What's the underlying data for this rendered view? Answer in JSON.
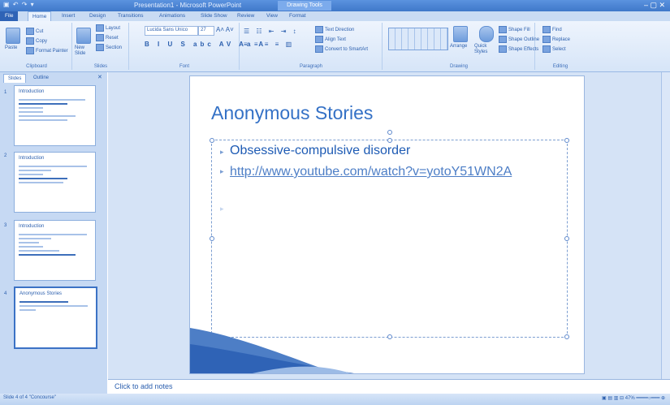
{
  "window": {
    "title": "Presentation1 - Microsoft PowerPoint",
    "context_tab": "Drawing Tools",
    "quick_access": "▣ ↶ ↷ ▾",
    "window_controls": "– ▢ ✕"
  },
  "tabs": [
    "File",
    "Home",
    "Insert",
    "Design",
    "Transitions",
    "Animations",
    "Slide Show",
    "Review",
    "View",
    "Format"
  ],
  "ribbon": {
    "clipboard": {
      "paste": "Paste",
      "cut": "Cut",
      "copy": "Copy",
      "format_painter": "Format Painter",
      "label": "Clipboard"
    },
    "slides": {
      "new_slide": "New Slide",
      "layout": "Layout",
      "reset": "Reset",
      "section": "Section",
      "label": "Slides"
    },
    "font": {
      "font_name": "Lucida Sans Unico",
      "font_size": "27",
      "label": "Font"
    },
    "paragraph": {
      "text_direction": "Text Direction",
      "align_text": "Align Text",
      "convert_smartart": "Convert to SmartArt",
      "label": "Paragraph"
    },
    "drawing": {
      "arrange": "Arrange",
      "quick_styles": "Quick Styles",
      "shape_fill": "Shape Fill",
      "shape_outline": "Shape Outline",
      "shape_effects": "Shape Effects",
      "label": "Drawing"
    },
    "editing": {
      "find": "Find",
      "replace": "Replace",
      "select": "Select",
      "label": "Editing"
    }
  },
  "pane": {
    "tabs": [
      "Slides",
      "Outline"
    ],
    "thumbnails": [
      {
        "number": "1",
        "title": "Introduction"
      },
      {
        "number": "2",
        "title": "Introduction"
      },
      {
        "number": "3",
        "title": "Introduction"
      },
      {
        "number": "4",
        "title": "Anonymous Stories"
      }
    ]
  },
  "slide": {
    "title": "Anonymous Stories",
    "bullets": [
      "Obsessive-compulsive disorder",
      "http://www.youtube.com/watch?v=yotoY51WN2A"
    ]
  },
  "notes": {
    "placeholder": "Click to add notes"
  },
  "status": {
    "left": "Slide 4 of 4   \"Concourse\"",
    "right": "▣ ▤ ▥ ⊟  47%  ━━━━○━━━  ⊕"
  }
}
